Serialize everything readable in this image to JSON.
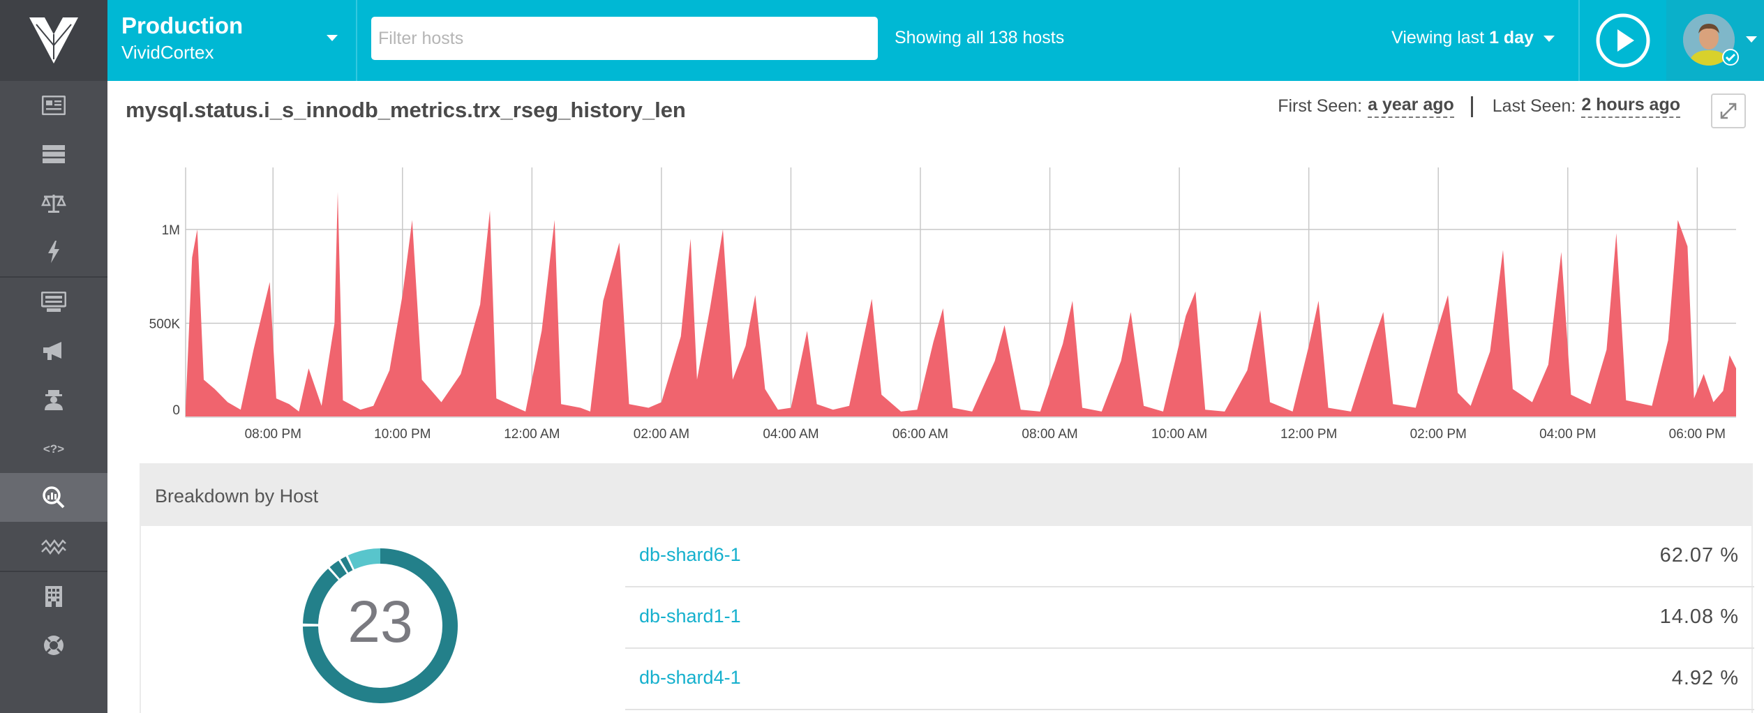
{
  "app": {
    "logo_icon": "vividcortex-logo-icon"
  },
  "sidebar": {
    "items": [
      {
        "id": "dashboard",
        "icon": "news-icon"
      },
      {
        "id": "inventory",
        "icon": "stack-icon"
      },
      {
        "id": "compare",
        "icon": "scales-icon"
      },
      {
        "id": "events",
        "icon": "bolt-icon"
      },
      {
        "id": "hosts",
        "icon": "server-icon"
      },
      {
        "id": "alerts",
        "icon": "megaphone-icon"
      },
      {
        "id": "users",
        "icon": "agent-icon"
      },
      {
        "id": "queries",
        "icon": "code-icon"
      },
      {
        "id": "metrics-explorer",
        "icon": "magnify-chart-icon",
        "active": true
      },
      {
        "id": "anomalies",
        "icon": "waves-icon"
      },
      {
        "id": "organization",
        "icon": "building-icon"
      },
      {
        "id": "help",
        "icon": "lifebuoy-icon"
      }
    ]
  },
  "header": {
    "environment": "Production",
    "organization": "VividCortex",
    "filter_placeholder": "Filter hosts",
    "filter_value": "",
    "showing_text": "Showing all 138 hosts",
    "viewing_prefix": "Viewing last ",
    "viewing_range": "1 day",
    "play_icon": "play-icon",
    "avatar_icon": "user-avatar"
  },
  "metric": {
    "name": "mysql.status.i_s_innodb_metrics.trx_rseg_history_len",
    "first_seen_label": "First Seen:",
    "first_seen_value": "a year ago",
    "last_seen_label": "Last Seen:",
    "last_seen_value": "2 hours ago",
    "expand_icon": "expand-icon"
  },
  "chart_data": {
    "type": "area",
    "color": "#f0646e",
    "title": "",
    "xlabel": "",
    "ylabel": "",
    "ylim": [
      0,
      1330000
    ],
    "y_ticks": [
      {
        "v": 0,
        "label": "0"
      },
      {
        "v": 500000,
        "label": "500K"
      },
      {
        "v": 1000000,
        "label": "1M"
      }
    ],
    "x_range_hours": [
      -1.35,
      22.6
    ],
    "x_ticks": [
      "08:00 PM",
      "10:00 PM",
      "12:00 AM",
      "02:00 AM",
      "04:00 AM",
      "06:00 AM",
      "08:00 AM",
      "10:00 AM",
      "12:00 PM",
      "02:00 PM",
      "04:00 PM",
      "06:00 PM"
    ],
    "x_tick_hours": [
      0,
      2,
      4,
      6,
      8,
      10,
      12,
      14,
      16,
      18,
      20,
      22
    ],
    "grid": true,
    "points": [
      [
        -1.35,
        50000
      ],
      [
        -1.25,
        850000
      ],
      [
        -1.17,
        1000000
      ],
      [
        -1.07,
        200000
      ],
      [
        -0.9,
        150000
      ],
      [
        -0.7,
        80000
      ],
      [
        -0.5,
        40000
      ],
      [
        -0.3,
        360000
      ],
      [
        -0.05,
        720000
      ],
      [
        0.05,
        100000
      ],
      [
        0.25,
        70000
      ],
      [
        0.4,
        30000
      ],
      [
        0.55,
        260000
      ],
      [
        0.75,
        60000
      ],
      [
        0.95,
        500000
      ],
      [
        1.0,
        1200000
      ],
      [
        1.08,
        90000
      ],
      [
        1.35,
        40000
      ],
      [
        1.55,
        60000
      ],
      [
        1.8,
        250000
      ],
      [
        2.0,
        650000
      ],
      [
        2.15,
        1050000
      ],
      [
        2.3,
        200000
      ],
      [
        2.6,
        80000
      ],
      [
        2.9,
        230000
      ],
      [
        3.2,
        600000
      ],
      [
        3.35,
        1100000
      ],
      [
        3.45,
        100000
      ],
      [
        3.7,
        60000
      ],
      [
        3.9,
        30000
      ],
      [
        4.15,
        460000
      ],
      [
        4.35,
        1050000
      ],
      [
        4.45,
        70000
      ],
      [
        4.75,
        50000
      ],
      [
        4.9,
        30000
      ],
      [
        5.1,
        620000
      ],
      [
        5.35,
        930000
      ],
      [
        5.5,
        70000
      ],
      [
        5.8,
        50000
      ],
      [
        6.0,
        80000
      ],
      [
        6.3,
        430000
      ],
      [
        6.45,
        950000
      ],
      [
        6.55,
        200000
      ],
      [
        6.75,
        580000
      ],
      [
        6.95,
        1000000
      ],
      [
        7.1,
        200000
      ],
      [
        7.3,
        380000
      ],
      [
        7.45,
        650000
      ],
      [
        7.6,
        150000
      ],
      [
        7.8,
        40000
      ],
      [
        8.0,
        50000
      ],
      [
        8.25,
        460000
      ],
      [
        8.4,
        70000
      ],
      [
        8.65,
        40000
      ],
      [
        8.9,
        60000
      ],
      [
        9.25,
        630000
      ],
      [
        9.4,
        120000
      ],
      [
        9.7,
        30000
      ],
      [
        9.95,
        40000
      ],
      [
        10.2,
        400000
      ],
      [
        10.35,
        580000
      ],
      [
        10.5,
        50000
      ],
      [
        10.8,
        30000
      ],
      [
        11.15,
        300000
      ],
      [
        11.3,
        490000
      ],
      [
        11.55,
        40000
      ],
      [
        11.85,
        30000
      ],
      [
        12.2,
        390000
      ],
      [
        12.35,
        620000
      ],
      [
        12.5,
        50000
      ],
      [
        12.8,
        30000
      ],
      [
        13.1,
        300000
      ],
      [
        13.25,
        560000
      ],
      [
        13.45,
        60000
      ],
      [
        13.75,
        30000
      ],
      [
        14.1,
        540000
      ],
      [
        14.25,
        670000
      ],
      [
        14.4,
        40000
      ],
      [
        14.7,
        30000
      ],
      [
        15.05,
        250000
      ],
      [
        15.25,
        570000
      ],
      [
        15.4,
        80000
      ],
      [
        15.75,
        30000
      ],
      [
        16.0,
        380000
      ],
      [
        16.15,
        620000
      ],
      [
        16.3,
        50000
      ],
      [
        16.65,
        30000
      ],
      [
        17.0,
        410000
      ],
      [
        17.15,
        560000
      ],
      [
        17.3,
        70000
      ],
      [
        17.65,
        50000
      ],
      [
        18.0,
        480000
      ],
      [
        18.15,
        650000
      ],
      [
        18.3,
        130000
      ],
      [
        18.5,
        60000
      ],
      [
        18.8,
        350000
      ],
      [
        19.0,
        890000
      ],
      [
        19.15,
        150000
      ],
      [
        19.45,
        80000
      ],
      [
        19.7,
        280000
      ],
      [
        19.9,
        880000
      ],
      [
        20.05,
        120000
      ],
      [
        20.35,
        70000
      ],
      [
        20.6,
        360000
      ],
      [
        20.75,
        980000
      ],
      [
        20.9,
        90000
      ],
      [
        21.3,
        60000
      ],
      [
        21.55,
        410000
      ],
      [
        21.7,
        1050000
      ],
      [
        21.85,
        910000
      ],
      [
        21.95,
        100000
      ],
      [
        22.1,
        230000
      ],
      [
        22.25,
        80000
      ],
      [
        22.4,
        140000
      ],
      [
        22.5,
        330000
      ],
      [
        22.6,
        260000
      ]
    ]
  },
  "breakdown": {
    "title": "Breakdown by Host",
    "count": "23",
    "hosts": [
      {
        "name": "db-shard6-1",
        "pct": "62.07 %"
      },
      {
        "name": "db-shard1-1",
        "pct": "14.08 %"
      },
      {
        "name": "db-shard4-1",
        "pct": "4.92 %"
      }
    ],
    "donut_colors": [
      "#23808a",
      "#58c5cc"
    ]
  }
}
